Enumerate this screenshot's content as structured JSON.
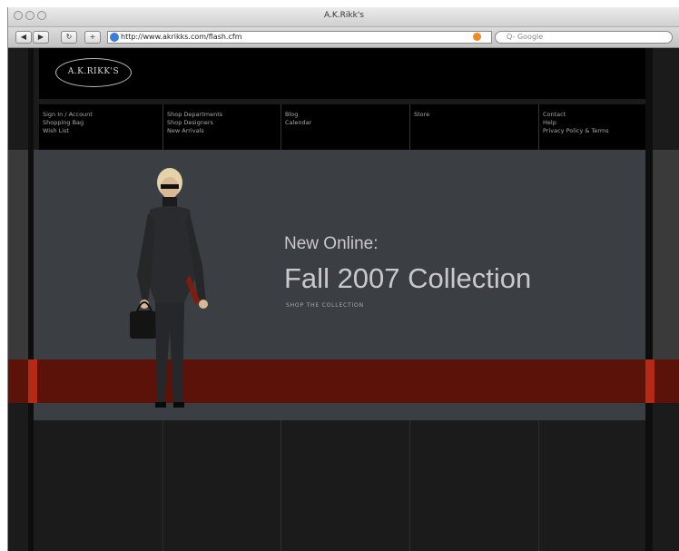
{
  "window": {
    "title": "A.K.Rikk's"
  },
  "toolbar": {
    "back_label": "◀",
    "forward_label": "▶",
    "reload_label": "↻",
    "add_label": "+",
    "url": "http://www.akrikks.com/flash.cfm",
    "search_placeholder": "Q- Google"
  },
  "site": {
    "logo_text": "A.K.RIKK'S",
    "nav": [
      {
        "lines": [
          "Sign In / Account",
          "Shopping Bag",
          "Wish List"
        ]
      },
      {
        "lines": [
          "Shop Departments",
          "Shop Designers",
          "New Arrivals"
        ]
      },
      {
        "lines": [
          "Blog",
          "Calendar"
        ]
      },
      {
        "lines": [
          "Store"
        ]
      },
      {
        "lines": [
          "Contact",
          "Help",
          "Privacy Policy & Terms"
        ]
      }
    ],
    "hero": {
      "line1": "New Online:",
      "line2": "Fall 2007 Collection",
      "cta": "SHOP THE COLLECTION"
    }
  },
  "colors": {
    "page_bg": "#1b1b1b",
    "hero_bg": "#3b3e43",
    "red_band": "#5a1209",
    "red_accent": "#b52a14"
  }
}
